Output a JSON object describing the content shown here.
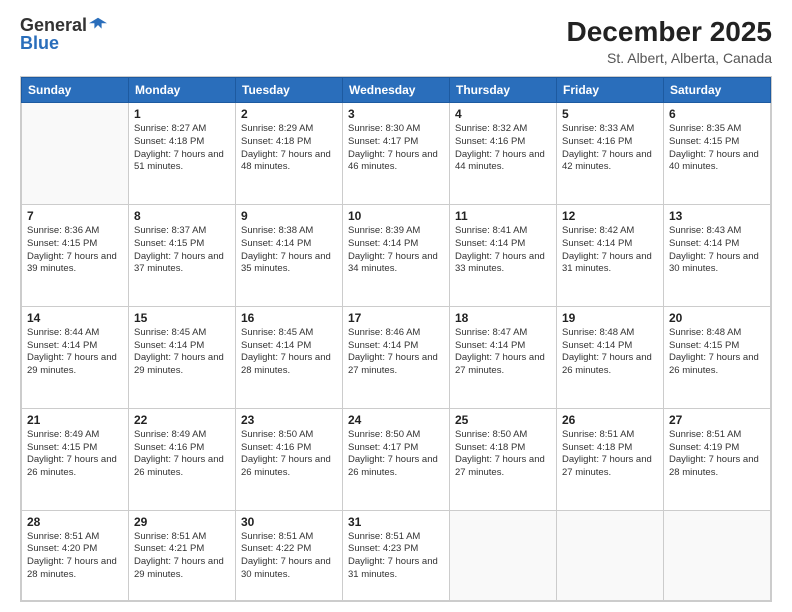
{
  "logo": {
    "general": "General",
    "blue": "Blue"
  },
  "title": "December 2025",
  "location": "St. Albert, Alberta, Canada",
  "headers": [
    "Sunday",
    "Monday",
    "Tuesday",
    "Wednesday",
    "Thursday",
    "Friday",
    "Saturday"
  ],
  "weeks": [
    [
      {
        "day": "",
        "sunrise": "",
        "sunset": "",
        "daylight": ""
      },
      {
        "day": "1",
        "sunrise": "Sunrise: 8:27 AM",
        "sunset": "Sunset: 4:18 PM",
        "daylight": "Daylight: 7 hours and 51 minutes."
      },
      {
        "day": "2",
        "sunrise": "Sunrise: 8:29 AM",
        "sunset": "Sunset: 4:18 PM",
        "daylight": "Daylight: 7 hours and 48 minutes."
      },
      {
        "day": "3",
        "sunrise": "Sunrise: 8:30 AM",
        "sunset": "Sunset: 4:17 PM",
        "daylight": "Daylight: 7 hours and 46 minutes."
      },
      {
        "day": "4",
        "sunrise": "Sunrise: 8:32 AM",
        "sunset": "Sunset: 4:16 PM",
        "daylight": "Daylight: 7 hours and 44 minutes."
      },
      {
        "day": "5",
        "sunrise": "Sunrise: 8:33 AM",
        "sunset": "Sunset: 4:16 PM",
        "daylight": "Daylight: 7 hours and 42 minutes."
      },
      {
        "day": "6",
        "sunrise": "Sunrise: 8:35 AM",
        "sunset": "Sunset: 4:15 PM",
        "daylight": "Daylight: 7 hours and 40 minutes."
      }
    ],
    [
      {
        "day": "7",
        "sunrise": "Sunrise: 8:36 AM",
        "sunset": "Sunset: 4:15 PM",
        "daylight": "Daylight: 7 hours and 39 minutes."
      },
      {
        "day": "8",
        "sunrise": "Sunrise: 8:37 AM",
        "sunset": "Sunset: 4:15 PM",
        "daylight": "Daylight: 7 hours and 37 minutes."
      },
      {
        "day": "9",
        "sunrise": "Sunrise: 8:38 AM",
        "sunset": "Sunset: 4:14 PM",
        "daylight": "Daylight: 7 hours and 35 minutes."
      },
      {
        "day": "10",
        "sunrise": "Sunrise: 8:39 AM",
        "sunset": "Sunset: 4:14 PM",
        "daylight": "Daylight: 7 hours and 34 minutes."
      },
      {
        "day": "11",
        "sunrise": "Sunrise: 8:41 AM",
        "sunset": "Sunset: 4:14 PM",
        "daylight": "Daylight: 7 hours and 33 minutes."
      },
      {
        "day": "12",
        "sunrise": "Sunrise: 8:42 AM",
        "sunset": "Sunset: 4:14 PM",
        "daylight": "Daylight: 7 hours and 31 minutes."
      },
      {
        "day": "13",
        "sunrise": "Sunrise: 8:43 AM",
        "sunset": "Sunset: 4:14 PM",
        "daylight": "Daylight: 7 hours and 30 minutes."
      }
    ],
    [
      {
        "day": "14",
        "sunrise": "Sunrise: 8:44 AM",
        "sunset": "Sunset: 4:14 PM",
        "daylight": "Daylight: 7 hours and 29 minutes."
      },
      {
        "day": "15",
        "sunrise": "Sunrise: 8:45 AM",
        "sunset": "Sunset: 4:14 PM",
        "daylight": "Daylight: 7 hours and 29 minutes."
      },
      {
        "day": "16",
        "sunrise": "Sunrise: 8:45 AM",
        "sunset": "Sunset: 4:14 PM",
        "daylight": "Daylight: 7 hours and 28 minutes."
      },
      {
        "day": "17",
        "sunrise": "Sunrise: 8:46 AM",
        "sunset": "Sunset: 4:14 PM",
        "daylight": "Daylight: 7 hours and 27 minutes."
      },
      {
        "day": "18",
        "sunrise": "Sunrise: 8:47 AM",
        "sunset": "Sunset: 4:14 PM",
        "daylight": "Daylight: 7 hours and 27 minutes."
      },
      {
        "day": "19",
        "sunrise": "Sunrise: 8:48 AM",
        "sunset": "Sunset: 4:14 PM",
        "daylight": "Daylight: 7 hours and 26 minutes."
      },
      {
        "day": "20",
        "sunrise": "Sunrise: 8:48 AM",
        "sunset": "Sunset: 4:15 PM",
        "daylight": "Daylight: 7 hours and 26 minutes."
      }
    ],
    [
      {
        "day": "21",
        "sunrise": "Sunrise: 8:49 AM",
        "sunset": "Sunset: 4:15 PM",
        "daylight": "Daylight: 7 hours and 26 minutes."
      },
      {
        "day": "22",
        "sunrise": "Sunrise: 8:49 AM",
        "sunset": "Sunset: 4:16 PM",
        "daylight": "Daylight: 7 hours and 26 minutes."
      },
      {
        "day": "23",
        "sunrise": "Sunrise: 8:50 AM",
        "sunset": "Sunset: 4:16 PM",
        "daylight": "Daylight: 7 hours and 26 minutes."
      },
      {
        "day": "24",
        "sunrise": "Sunrise: 8:50 AM",
        "sunset": "Sunset: 4:17 PM",
        "daylight": "Daylight: 7 hours and 26 minutes."
      },
      {
        "day": "25",
        "sunrise": "Sunrise: 8:50 AM",
        "sunset": "Sunset: 4:18 PM",
        "daylight": "Daylight: 7 hours and 27 minutes."
      },
      {
        "day": "26",
        "sunrise": "Sunrise: 8:51 AM",
        "sunset": "Sunset: 4:18 PM",
        "daylight": "Daylight: 7 hours and 27 minutes."
      },
      {
        "day": "27",
        "sunrise": "Sunrise: 8:51 AM",
        "sunset": "Sunset: 4:19 PM",
        "daylight": "Daylight: 7 hours and 28 minutes."
      }
    ],
    [
      {
        "day": "28",
        "sunrise": "Sunrise: 8:51 AM",
        "sunset": "Sunset: 4:20 PM",
        "daylight": "Daylight: 7 hours and 28 minutes."
      },
      {
        "day": "29",
        "sunrise": "Sunrise: 8:51 AM",
        "sunset": "Sunset: 4:21 PM",
        "daylight": "Daylight: 7 hours and 29 minutes."
      },
      {
        "day": "30",
        "sunrise": "Sunrise: 8:51 AM",
        "sunset": "Sunset: 4:22 PM",
        "daylight": "Daylight: 7 hours and 30 minutes."
      },
      {
        "day": "31",
        "sunrise": "Sunrise: 8:51 AM",
        "sunset": "Sunset: 4:23 PM",
        "daylight": "Daylight: 7 hours and 31 minutes."
      },
      {
        "day": "",
        "sunrise": "",
        "sunset": "",
        "daylight": ""
      },
      {
        "day": "",
        "sunrise": "",
        "sunset": "",
        "daylight": ""
      },
      {
        "day": "",
        "sunrise": "",
        "sunset": "",
        "daylight": ""
      }
    ]
  ]
}
